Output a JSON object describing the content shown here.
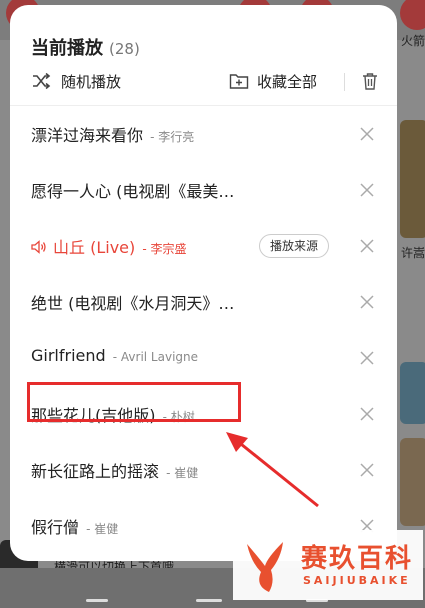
{
  "background_app": {
    "right_label_top": "火箭",
    "right_label_mid": "许嵩",
    "hint": "横滑可以切换上下首哦"
  },
  "panel": {
    "title": "当前播放",
    "count": "(28)",
    "shuffle_label": "随机播放",
    "collect_label": "收藏全部",
    "source_label": "播放来源"
  },
  "songs": [
    {
      "title": "漂洋过海来看你",
      "artist": "- 李行亮",
      "playing": false
    },
    {
      "title": "愿得一人心 (电视剧《最美…",
      "artist": "",
      "playing": false
    },
    {
      "title": "山丘 (Live)",
      "artist": "- 李宗盛",
      "playing": true
    },
    {
      "title": "绝世 (电视剧《水月洞天》…",
      "artist": "",
      "playing": false
    },
    {
      "title": "Girlfriend",
      "artist": "- Avril Lavigne",
      "playing": false
    },
    {
      "title": "那些花儿(吉他版)",
      "artist": "- 朴树",
      "playing": false
    },
    {
      "title": "新长征路上的摇滚",
      "artist": "- 崔健",
      "playing": false
    },
    {
      "title": "假行僧",
      "artist": "- 崔健",
      "playing": false
    }
  ],
  "watermark": {
    "cn": "赛玖百科",
    "en": "SAIJIUBAIKE"
  },
  "colors": {
    "accent": "#e8463a",
    "annotation": "#e62c2c"
  }
}
